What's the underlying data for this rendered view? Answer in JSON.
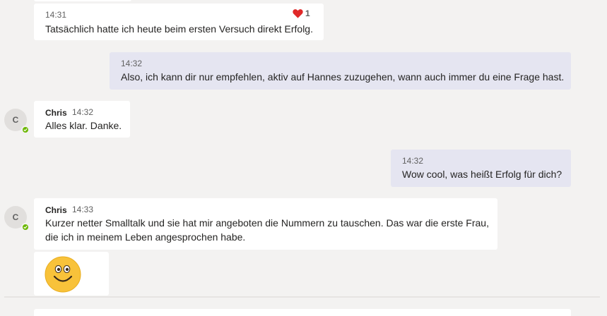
{
  "messages": [
    {
      "time": "14:31",
      "text": "Tatsächlich hatte ich heute beim ersten Versuch direkt Erfolg.",
      "reaction": {
        "icon": "heart-icon",
        "count": "1",
        "color": "#e02828"
      }
    },
    {
      "time": "14:32",
      "text": "Also, ich kann dir nur empfehlen, aktiv auf Hannes zuzugehen, wann auch immer du eine Frage hast."
    },
    {
      "sender": "Chris",
      "time": "14:32",
      "text": "Alles klar. Danke.",
      "avatar_initial": "C"
    },
    {
      "time": "14:32",
      "text": "Wow cool, was heißt Erfolg für dich?"
    },
    {
      "sender": "Chris",
      "time": "14:33",
      "text_line1": "Kurzer netter Smalltalk und sie hat mir angeboten die Nummern zu tauschen. Das war die erste Frau,",
      "text_line2": "die ich in meinem Leben angesprochen habe.",
      "avatar_initial": "C"
    },
    {
      "emoji": "smiley-emoji"
    }
  ],
  "colors": {
    "incoming_bubble": "#ffffff",
    "outgoing_bubble": "#e5e5f1",
    "presence": "#6bb700",
    "background": "#f3f2f1"
  }
}
